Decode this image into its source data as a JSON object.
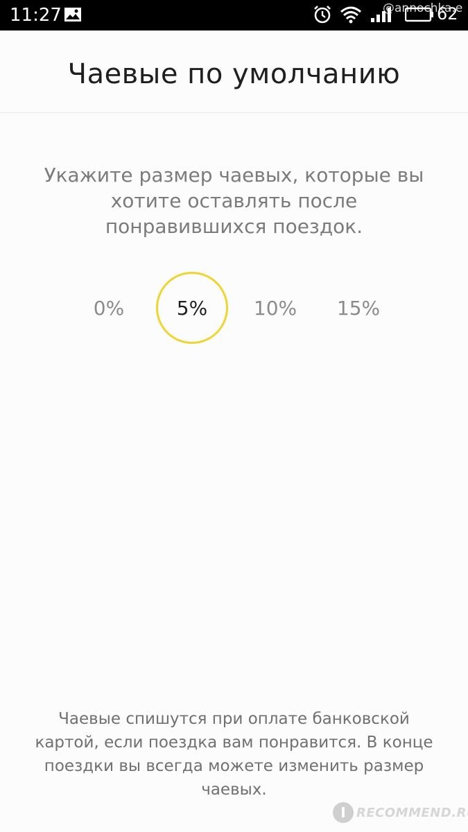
{
  "status_bar": {
    "time": "11:27",
    "battery": "62",
    "icons": [
      "image-icon",
      "alarm-icon",
      "wifi-icon",
      "signal-icon",
      "battery-icon"
    ],
    "watermark": "@annochka.e"
  },
  "header": {
    "title": "Чаевые по умолчанию"
  },
  "instruction": "Укажите размер чаевых, которые вы хотите оставлять после понравившихся поездок.",
  "tips": {
    "selected": "5%",
    "options": [
      "0%",
      "5%",
      "10%",
      "15%"
    ],
    "accent_color": "#f0d431"
  },
  "footer_note": "Чаевые спишутся при оплате банковской картой, если поездка вам понравится. В конце поездки вы всегда можете изменить размер чаевых.",
  "watermark": {
    "badge": "I",
    "text": "RECOMMEND.RU"
  }
}
